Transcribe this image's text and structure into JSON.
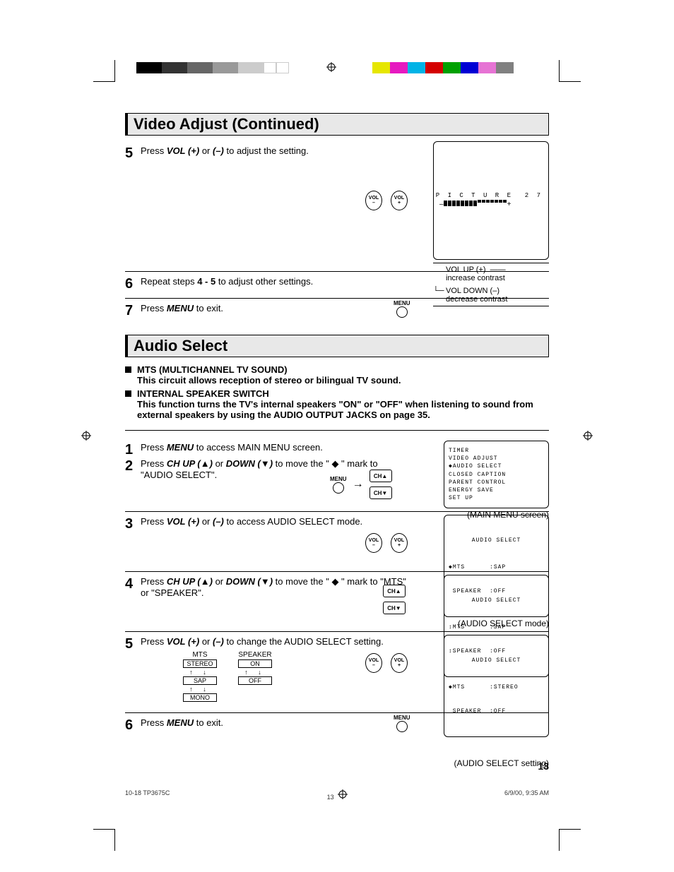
{
  "sections": {
    "video_adjust_title": "Video Adjust (Continued)",
    "audio_select_title": "Audio Select"
  },
  "video_steps": {
    "s5": {
      "num": "5",
      "prefix": "Press ",
      "btn1": "VOL (+)",
      "mid": " or ",
      "btn2": "(–)",
      "suffix": " to adjust the setting."
    },
    "s6": {
      "num": "6",
      "prefix": "Repeat steps ",
      "bold": "4 - 5",
      "suffix": " to adjust other settings."
    },
    "s7": {
      "num": "7",
      "prefix": "Press ",
      "btn": "MENU",
      "suffix": " to exit."
    }
  },
  "vol_btn_minus": "VOL\n–",
  "vol_btn_plus": "VOL\n+",
  "ch_btn_up": "CH▲",
  "ch_btn_down": "CH▼",
  "menu_label": "MENU",
  "picture_screen": {
    "label": "P I C T U R E",
    "value": "2 7",
    "up_line1": "VOL UP (+)",
    "up_line2": "increase contrast",
    "down_line1": "VOL DOWN (–)",
    "down_line2": "decrease contrast"
  },
  "audio_intro": {
    "b1_title": "MTS (MULTICHANNEL TV SOUND)",
    "b1_text": "This circuit allows reception of stereo or bilingual TV sound.",
    "b2_title": "INTERNAL SPEAKER SWITCH",
    "b2_text": "This function turns the TV's internal speakers \"ON\" or \"OFF\" when listening to sound from external speakers by using the AUDIO OUTPUT JACKS on page 35."
  },
  "audio_steps": {
    "s1": {
      "num": "1",
      "prefix": "Press ",
      "btn": "MENU",
      "suffix": " to access MAIN MENU screen."
    },
    "s2": {
      "num": "2",
      "prefix": "Press ",
      "btn1": "CH UP (▲)",
      "mid": " or ",
      "btn2": "DOWN (▼)",
      "mid2": " to move the \" ",
      "mark": "◆",
      "suffix": " \" mark to \"AUDIO SELECT\"."
    },
    "s3": {
      "num": "3",
      "prefix": "Press ",
      "btn1": "VOL (+)",
      "mid": " or ",
      "btn2": "(–)",
      "suffix": " to access AUDIO SELECT mode."
    },
    "s4": {
      "num": "4",
      "prefix": "Press ",
      "btn1": "CH UP (▲)",
      "mid": " or ",
      "btn2": "DOWN (▼)",
      "mid2": " to move the \" ",
      "mark": "◆",
      "suffix": " \" mark to \"MTS\" or \"SPEAKER\"."
    },
    "s5": {
      "num": "5",
      "prefix": "Press ",
      "btn1": "VOL (+)",
      "mid": " or ",
      "btn2": "(–)",
      "suffix": " to change the AUDIO SELECT setting."
    },
    "s6": {
      "num": "6",
      "prefix": "Press ",
      "btn": "MENU",
      "suffix": " to exit."
    }
  },
  "main_menu_screen": {
    "l1": "TIMER",
    "l2": "VIDEO ADJUST",
    "l3": "◆AUDIO SELECT",
    "l4": "CLOSED CAPTION",
    "l5": "PARENT CONTROL",
    "l6": "ENERGY SAVE",
    "l7": "SET UP",
    "caption": "(MAIN MENU screen)"
  },
  "audio_mode_screen": {
    "title": "AUDIO SELECT",
    "l1": "◆MTS      :SAP",
    "l2": " SPEAKER  :OFF",
    "caption": "(AUDIO SELECT mode)"
  },
  "audio_move_screen": {
    "title": "AUDIO SELECT",
    "l1": "↕MTS      :SAP",
    "l2": "↕SPEAKER  :OFF"
  },
  "audio_setting_screen": {
    "title": "AUDIO SELECT",
    "l1": "◆MTS      :STEREO",
    "l2": " SPEAKER  :OFF",
    "caption": "(AUDIO SELECT setting)"
  },
  "options": {
    "mts_hdr": "MTS",
    "mts_o1": "STEREO",
    "mts_o2": "SAP",
    "mts_o3": "MONO",
    "spk_hdr": "SPEAKER",
    "spk_o1": "ON",
    "spk_o2": "OFF",
    "arrows": "↑  ↓"
  },
  "page_number": "13",
  "footer": {
    "left": "10-18 TP3675C",
    "mid": "13",
    "right": "6/9/00, 9:35 AM"
  }
}
